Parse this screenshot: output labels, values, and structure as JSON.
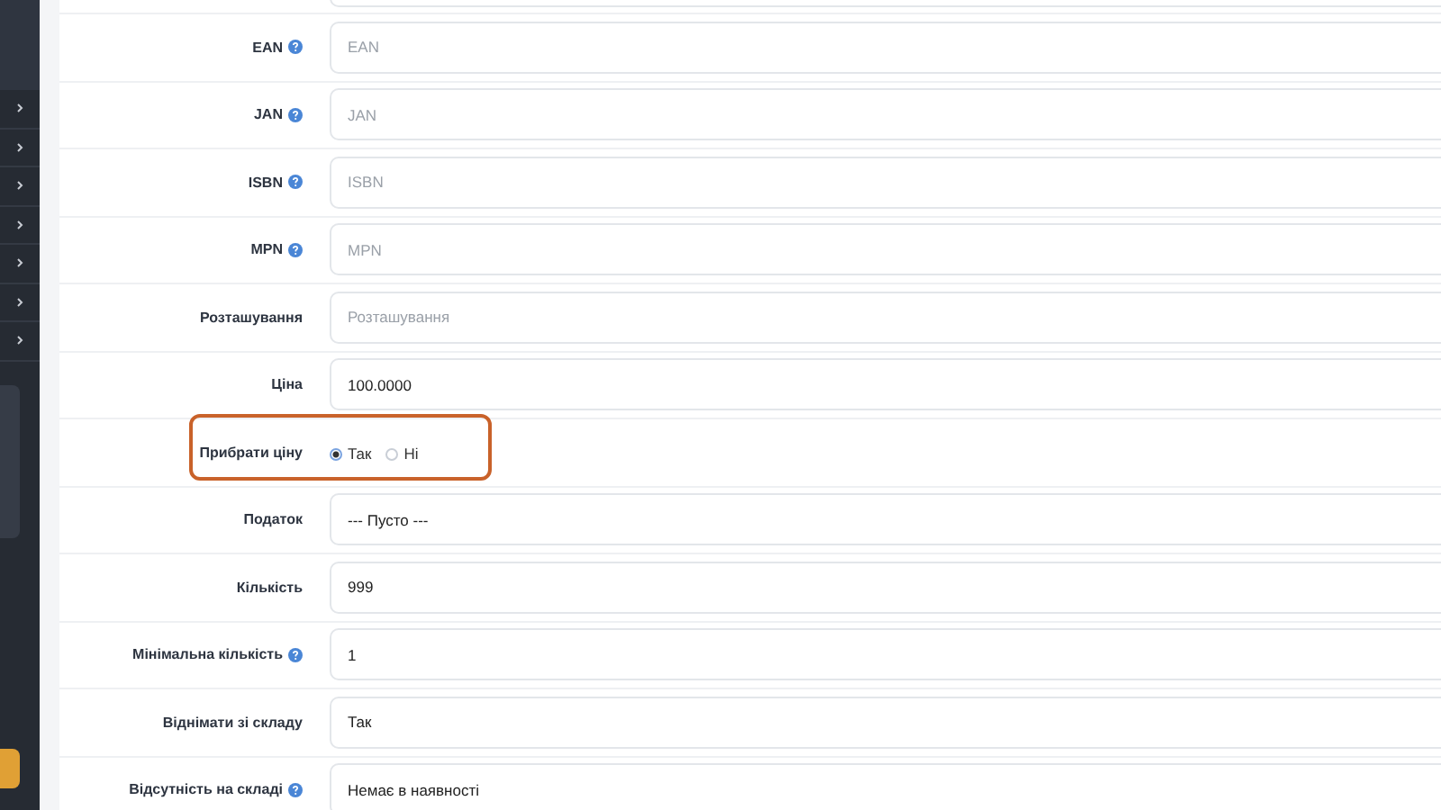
{
  "fields": [
    {
      "label": "EAN",
      "help": true,
      "kind": "text",
      "placeholder": "EAN"
    },
    {
      "label": "JAN",
      "help": true,
      "kind": "text",
      "placeholder": "JAN"
    },
    {
      "label": "ISBN",
      "help": true,
      "kind": "text",
      "placeholder": "ISBN"
    },
    {
      "label": "MPN",
      "help": true,
      "kind": "text",
      "placeholder": "MPN"
    },
    {
      "label": "Розташування",
      "help": false,
      "kind": "text",
      "placeholder": "Розташування"
    },
    {
      "label": "Ціна",
      "help": false,
      "kind": "text",
      "value": "100.0000"
    },
    {
      "label": "Прибрати ціну",
      "help": false,
      "kind": "radio",
      "highlighted": true,
      "options": [
        {
          "label": "Так",
          "selected": true
        },
        {
          "label": "Ні",
          "selected": false
        }
      ]
    },
    {
      "label": "Податок",
      "help": false,
      "kind": "select",
      "value": "--- Пусто ---"
    },
    {
      "label": "Кількість",
      "help": false,
      "kind": "text",
      "value": "999"
    },
    {
      "label": "Мінімальна кількість",
      "help": true,
      "kind": "text",
      "value": "1"
    },
    {
      "label": "Віднімати зі складу",
      "help": false,
      "kind": "select",
      "value": "Так"
    },
    {
      "label": "Відсутність на складі",
      "help": true,
      "kind": "select",
      "value": "Немає в наявності"
    }
  ]
}
